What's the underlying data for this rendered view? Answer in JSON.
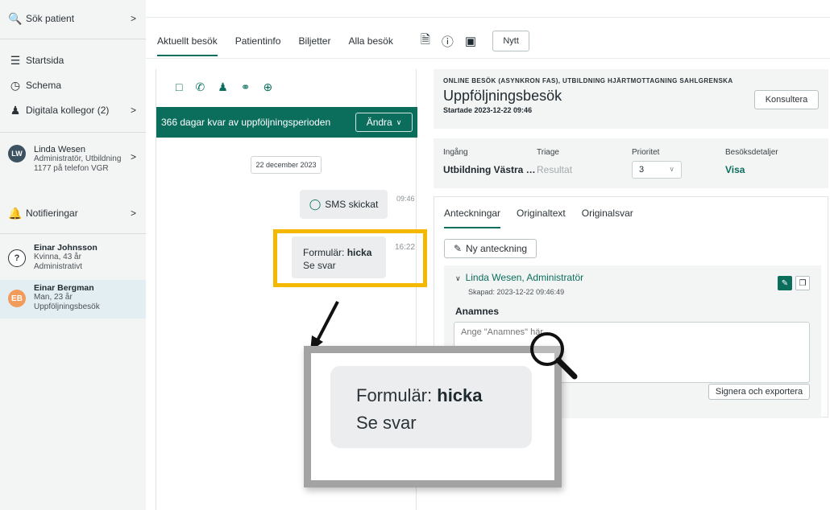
{
  "sidebar": {
    "search": "Sök patient",
    "items": [
      {
        "label": "Startsida",
        "icon": "list-icon"
      },
      {
        "label": "Schema",
        "icon": "clock-icon"
      },
      {
        "label": "Digitala kollegor (2)",
        "icon": "people-icon"
      }
    ],
    "user": {
      "initials": "LW",
      "name": "Linda Wesen",
      "role": "Administratör, Utbildning 1177 på telefon VGR"
    },
    "notifications": "Notifieringar",
    "patients": [
      {
        "initials": "?",
        "name": "Einar Johnsson",
        "line1": "Kvinna, 43 år",
        "line2": "Administrativt"
      },
      {
        "initials": "EB",
        "name": "Einar Bergman",
        "line1": "Man, 23 år",
        "line2": "Uppföljningsbesök"
      }
    ]
  },
  "tabs": [
    "Aktuellt besök",
    "Patientinfo",
    "Biljetter",
    "Alla besök"
  ],
  "nytt_label": "Nytt",
  "chat": {
    "period_text": "366 dagar kvar av uppföljningsperioden",
    "andra_label": "Ändra",
    "date": "22 december 2023",
    "sms_label": "SMS skickat",
    "sms_time": "09:46",
    "form_prefix": "Formulär:",
    "form_name": "hicka",
    "form_link": "Se svar",
    "form_time": "16:22"
  },
  "visit": {
    "type": "ONLINE BESÖK (ASYNKRON FAS), UTBILDNING HJÄRTMOTTAGNING SAHLGRENSKA",
    "title": "Uppföljningsbesök",
    "started": "Startade 2023-12-22 09:46",
    "konsultera": "Konsultera"
  },
  "details": {
    "ingang_label": "Ingång",
    "ingang_value": "Utbildning Västra …",
    "triage_label": "Triage",
    "triage_value": "Resultat",
    "prioritet_label": "Prioritet",
    "prioritet_value": "3",
    "besok_label": "Besöksdetaljer",
    "besok_value": "Visa"
  },
  "notes": {
    "tabs": [
      "Anteckningar",
      "Originaltext",
      "Originalsvar"
    ],
    "new_note": "Ny anteckning",
    "author": "Linda Wesen, Administratör",
    "created": "Skapad: 2023-12-22 09:46:49",
    "anamnes_label": "Anamnes",
    "anamnes_placeholder": "Ange \"Anamnes\" här",
    "sign_export": "Signera och exportera"
  },
  "zoom": {
    "form_prefix": "Formulär:",
    "form_name": "hicka",
    "form_link": "Se svar"
  },
  "colors": {
    "accent": "#0b6e5d",
    "highlight": "#f5b800"
  }
}
